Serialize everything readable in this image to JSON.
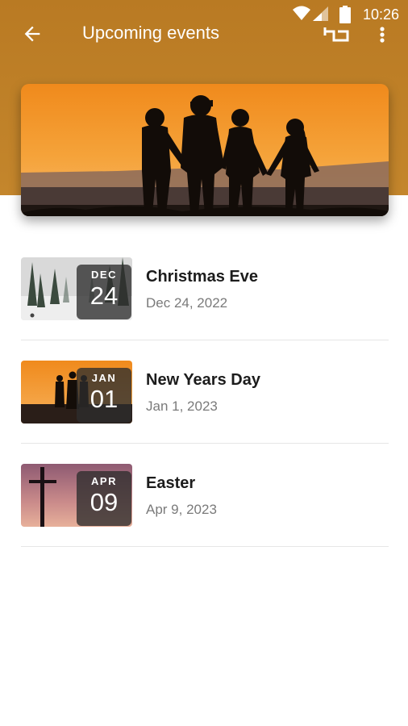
{
  "status_bar": {
    "time": "10:26",
    "icons": [
      "wifi-icon",
      "signal-icon",
      "battery-icon"
    ]
  },
  "app_bar": {
    "title": "Upcoming events",
    "back_icon": "arrow-left-icon",
    "cast_icon": "cast-icon",
    "more_icon": "more-vertical-icon"
  },
  "colors": {
    "header": "#c0822a",
    "divider": "#e6e6e6",
    "title_text": "#1c1c1c",
    "date_text": "#7a7a7a"
  },
  "events": [
    {
      "month": "DEC",
      "day": "24",
      "name": "Christmas Eve",
      "date": "Dec 24, 2022",
      "image": "snowy-forest"
    },
    {
      "month": "JAN",
      "day": "01",
      "name": "New Years Day",
      "date": "Jan 1, 2023",
      "image": "sunset-silhouettes"
    },
    {
      "month": "APR",
      "day": "09",
      "name": "Easter",
      "date": "Apr 9, 2023",
      "image": "cross-at-dusk"
    }
  ]
}
